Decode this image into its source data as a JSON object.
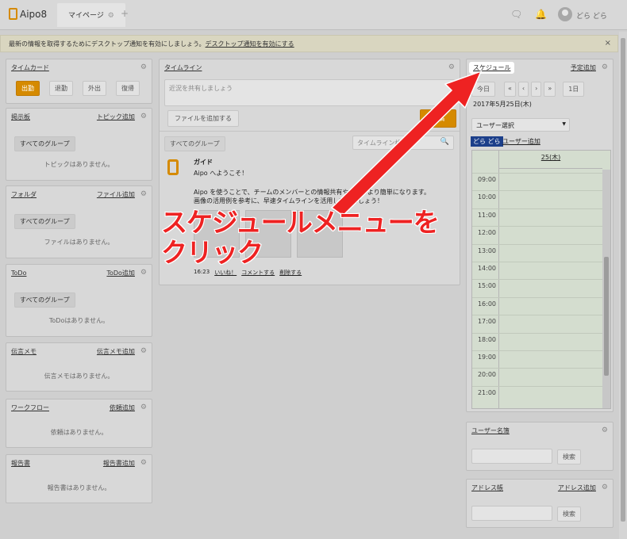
{
  "app": {
    "logo": "Aipo8",
    "tab": "マイページ",
    "user": "どら どら"
  },
  "notice": {
    "text": "最新の情報を取得するためにデスクトップ通知を有効にしましょう。",
    "link": "デスクトップ通知を有効にする",
    "close": "×"
  },
  "timecard": {
    "title": "タイムカード",
    "buttons": [
      "出勤",
      "退勤",
      "外出",
      "復帰"
    ]
  },
  "board": {
    "title": "掲示板",
    "action": "トピック追加",
    "group": "すべてのグループ",
    "empty": "トピックはありません。"
  },
  "folder": {
    "title": "フォルダ",
    "action": "ファイル追加",
    "group": "すべてのグループ",
    "empty": "ファイルはありません。"
  },
  "todo": {
    "title": "ToDo",
    "action": "ToDo追加",
    "group": "すべてのグループ",
    "empty": "ToDoはありません。"
  },
  "memo": {
    "title": "伝言メモ",
    "action": "伝言メモ追加",
    "empty": "伝言メモはありません。"
  },
  "workflow": {
    "title": "ワークフロー",
    "action": "依頼追加",
    "empty": "依頼はありません。"
  },
  "report": {
    "title": "報告書",
    "action": "報告書追加",
    "empty": "報告書はありません。"
  },
  "timeline": {
    "title": "タイムライン",
    "placeholder": "近況を共有しましょう",
    "file_button": "ファイルを追加する",
    "post_button": "投稿",
    "group": "すべてのグループ",
    "search_placeholder": "タイムライン検索",
    "post": {
      "author": "ガイド",
      "greeting": "Aipo へようこそ！",
      "body1": "Aipo を使うことで、チームのメンバーとの情報共有や交流がより簡単になります。",
      "body2": "画像の活用例を参考に、早速タイムラインを活用してみましょう！",
      "time": "16:23",
      "like": "いいね！",
      "comment": "コメントする",
      "delete": "削除する"
    }
  },
  "schedule": {
    "title": "スケジュール",
    "action": "予定追加",
    "today": "今日",
    "nav": [
      "«",
      "‹",
      "›",
      "»"
    ],
    "one_day": "1日",
    "date": "2017年5月25日(木)",
    "user_select": "ユーザー選択",
    "user_badge": "どら どら",
    "user_add": "ユーザー追加",
    "day_header": "25(木)",
    "hours": [
      "09:00",
      "10:00",
      "11:00",
      "12:00",
      "13:00",
      "14:00",
      "15:00",
      "16:00",
      "17:00",
      "18:00",
      "19:00",
      "20:00",
      "21:00"
    ]
  },
  "user_directory": {
    "title": "ユーザー名簿",
    "search": "検索"
  },
  "address_book": {
    "title": "アドレス帳",
    "action": "アドレス追加",
    "search": "検索"
  },
  "annotation": {
    "line1": "スケジュールメニューを",
    "line2": "クリック",
    "color": "#ee2222"
  }
}
